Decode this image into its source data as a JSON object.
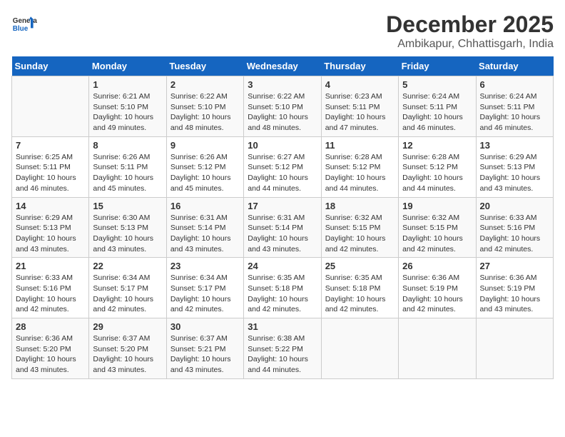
{
  "logo": {
    "general": "General",
    "blue": "Blue"
  },
  "header": {
    "month": "December 2025",
    "location": "Ambikapur, Chhattisgarh, India"
  },
  "days_of_week": [
    "Sunday",
    "Monday",
    "Tuesday",
    "Wednesday",
    "Thursday",
    "Friday",
    "Saturday"
  ],
  "weeks": [
    [
      {
        "day": "",
        "info": ""
      },
      {
        "day": "1",
        "info": "Sunrise: 6:21 AM\nSunset: 5:10 PM\nDaylight: 10 hours\nand 49 minutes."
      },
      {
        "day": "2",
        "info": "Sunrise: 6:22 AM\nSunset: 5:10 PM\nDaylight: 10 hours\nand 48 minutes."
      },
      {
        "day": "3",
        "info": "Sunrise: 6:22 AM\nSunset: 5:10 PM\nDaylight: 10 hours\nand 48 minutes."
      },
      {
        "day": "4",
        "info": "Sunrise: 6:23 AM\nSunset: 5:11 PM\nDaylight: 10 hours\nand 47 minutes."
      },
      {
        "day": "5",
        "info": "Sunrise: 6:24 AM\nSunset: 5:11 PM\nDaylight: 10 hours\nand 46 minutes."
      },
      {
        "day": "6",
        "info": "Sunrise: 6:24 AM\nSunset: 5:11 PM\nDaylight: 10 hours\nand 46 minutes."
      }
    ],
    [
      {
        "day": "7",
        "info": "Sunrise: 6:25 AM\nSunset: 5:11 PM\nDaylight: 10 hours\nand 46 minutes."
      },
      {
        "day": "8",
        "info": "Sunrise: 6:26 AM\nSunset: 5:11 PM\nDaylight: 10 hours\nand 45 minutes."
      },
      {
        "day": "9",
        "info": "Sunrise: 6:26 AM\nSunset: 5:12 PM\nDaylight: 10 hours\nand 45 minutes."
      },
      {
        "day": "10",
        "info": "Sunrise: 6:27 AM\nSunset: 5:12 PM\nDaylight: 10 hours\nand 44 minutes."
      },
      {
        "day": "11",
        "info": "Sunrise: 6:28 AM\nSunset: 5:12 PM\nDaylight: 10 hours\nand 44 minutes."
      },
      {
        "day": "12",
        "info": "Sunrise: 6:28 AM\nSunset: 5:12 PM\nDaylight: 10 hours\nand 44 minutes."
      },
      {
        "day": "13",
        "info": "Sunrise: 6:29 AM\nSunset: 5:13 PM\nDaylight: 10 hours\nand 43 minutes."
      }
    ],
    [
      {
        "day": "14",
        "info": "Sunrise: 6:29 AM\nSunset: 5:13 PM\nDaylight: 10 hours\nand 43 minutes."
      },
      {
        "day": "15",
        "info": "Sunrise: 6:30 AM\nSunset: 5:13 PM\nDaylight: 10 hours\nand 43 minutes."
      },
      {
        "day": "16",
        "info": "Sunrise: 6:31 AM\nSunset: 5:14 PM\nDaylight: 10 hours\nand 43 minutes."
      },
      {
        "day": "17",
        "info": "Sunrise: 6:31 AM\nSunset: 5:14 PM\nDaylight: 10 hours\nand 43 minutes."
      },
      {
        "day": "18",
        "info": "Sunrise: 6:32 AM\nSunset: 5:15 PM\nDaylight: 10 hours\nand 42 minutes."
      },
      {
        "day": "19",
        "info": "Sunrise: 6:32 AM\nSunset: 5:15 PM\nDaylight: 10 hours\nand 42 minutes."
      },
      {
        "day": "20",
        "info": "Sunrise: 6:33 AM\nSunset: 5:16 PM\nDaylight: 10 hours\nand 42 minutes."
      }
    ],
    [
      {
        "day": "21",
        "info": "Sunrise: 6:33 AM\nSunset: 5:16 PM\nDaylight: 10 hours\nand 42 minutes."
      },
      {
        "day": "22",
        "info": "Sunrise: 6:34 AM\nSunset: 5:17 PM\nDaylight: 10 hours\nand 42 minutes."
      },
      {
        "day": "23",
        "info": "Sunrise: 6:34 AM\nSunset: 5:17 PM\nDaylight: 10 hours\nand 42 minutes."
      },
      {
        "day": "24",
        "info": "Sunrise: 6:35 AM\nSunset: 5:18 PM\nDaylight: 10 hours\nand 42 minutes."
      },
      {
        "day": "25",
        "info": "Sunrise: 6:35 AM\nSunset: 5:18 PM\nDaylight: 10 hours\nand 42 minutes."
      },
      {
        "day": "26",
        "info": "Sunrise: 6:36 AM\nSunset: 5:19 PM\nDaylight: 10 hours\nand 42 minutes."
      },
      {
        "day": "27",
        "info": "Sunrise: 6:36 AM\nSunset: 5:19 PM\nDaylight: 10 hours\nand 43 minutes."
      }
    ],
    [
      {
        "day": "28",
        "info": "Sunrise: 6:36 AM\nSunset: 5:20 PM\nDaylight: 10 hours\nand 43 minutes."
      },
      {
        "day": "29",
        "info": "Sunrise: 6:37 AM\nSunset: 5:20 PM\nDaylight: 10 hours\nand 43 minutes."
      },
      {
        "day": "30",
        "info": "Sunrise: 6:37 AM\nSunset: 5:21 PM\nDaylight: 10 hours\nand 43 minutes."
      },
      {
        "day": "31",
        "info": "Sunrise: 6:38 AM\nSunset: 5:22 PM\nDaylight: 10 hours\nand 44 minutes."
      },
      {
        "day": "",
        "info": ""
      },
      {
        "day": "",
        "info": ""
      },
      {
        "day": "",
        "info": ""
      }
    ]
  ]
}
